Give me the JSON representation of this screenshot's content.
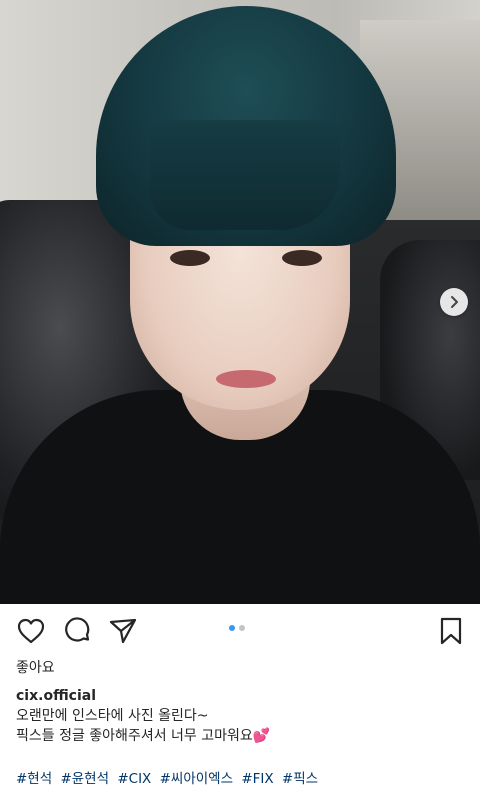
{
  "post": {
    "image_alt": "Selfie photo of a person with dark teal hair wearing a black t-shirt on a leather sofa",
    "carousel": {
      "count": 2,
      "active_index": 0
    },
    "likes_label": "좋아요",
    "username": "cix.official",
    "caption_lines": [
      "오랜만에 인스타에 사진 올린다~",
      "픽스들 정글 좋아해주셔서 너무 고마워요"
    ],
    "caption_emoji": "💕",
    "hashtags": [
      "#현석",
      "#윤현석",
      "#CIX",
      "#씨아이엑스",
      "#FIX",
      "#픽스"
    ]
  },
  "icons": {
    "like": "heart-icon",
    "comment": "comment-icon",
    "share": "send-icon",
    "save": "bookmark-icon",
    "next": "chevron-right-icon"
  },
  "colors": {
    "carousel_active": "#3897f0",
    "carousel_inactive": "#c4c4c4",
    "hashtag": "#003569",
    "heart_emoji": "#e84a8a"
  }
}
